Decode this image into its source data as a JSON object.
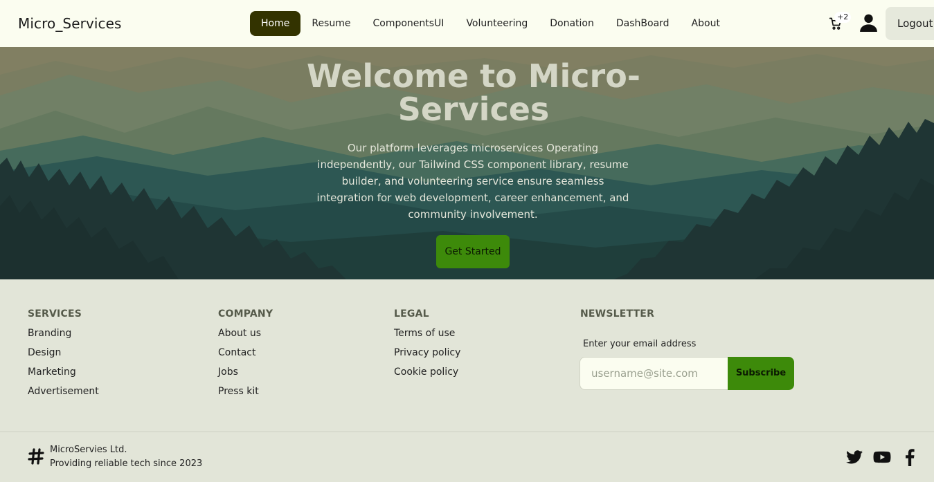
{
  "brand": "Micro_Services",
  "nav": {
    "items": [
      {
        "label": "Home",
        "active": true
      },
      {
        "label": "Resume"
      },
      {
        "label": "ComponentsUI"
      },
      {
        "label": "Volunteering"
      },
      {
        "label": "Donation"
      },
      {
        "label": "DashBoard"
      },
      {
        "label": "About"
      }
    ],
    "cart_icon": "cart-icon",
    "cart_count": "+2",
    "user_icon": "user-icon",
    "logout_label": "Logout"
  },
  "hero": {
    "title_line1": "Welcome to Micro-",
    "title_line2": "Services",
    "description": "Our platform leverages microservices Operating independently, our Tailwind CSS component library, resume builder, and volunteering service ensure seamless integration for web development, career enhancement, and community involvement.",
    "cta_label": "Get Started"
  },
  "footer": {
    "services": {
      "title": "SERVICES",
      "links": [
        "Branding",
        "Design",
        "Marketing",
        "Advertisement"
      ]
    },
    "company": {
      "title": "COMPANY",
      "links": [
        "About us",
        "Contact",
        "Jobs",
        "Press kit"
      ]
    },
    "legal": {
      "title": "LEGAL",
      "links": [
        "Terms of use",
        "Privacy policy",
        "Cookie policy"
      ]
    },
    "newsletter": {
      "title": "NEWSLETTER",
      "label": "Enter your email address",
      "placeholder": "username@site.com",
      "button_label": "Subscribe"
    },
    "company_name": "MicroServies Ltd.",
    "company_tagline": "Providing reliable tech since 2023",
    "social_icons": [
      "twitter-icon",
      "youtube-icon",
      "facebook-icon"
    ]
  },
  "colors": {
    "navbar_bg": "#fbfdf0",
    "active_nav": "#333300",
    "accent": "#3d8a0a",
    "footer_bg": "#e2e5d8"
  }
}
